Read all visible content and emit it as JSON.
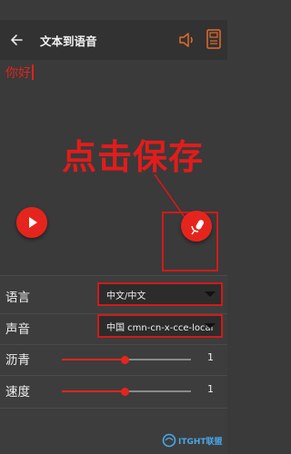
{
  "header": {
    "title": "文本到语音",
    "back_icon": "arrow-left-icon",
    "speaker_icon": "speaker-icon",
    "save_icon": "save-file-icon"
  },
  "editor": {
    "text": "你好"
  },
  "annotation": {
    "callout": "点击保存"
  },
  "actions": {
    "play_icon": "play-icon",
    "mic_icon": "microphone-icon"
  },
  "settings": {
    "language": {
      "label": "语言",
      "value": "中文/中文"
    },
    "voice": {
      "label": "声音",
      "value": "中国 cmn-cn-x-cce-local"
    },
    "pitch": {
      "label": "沥青",
      "value": "1",
      "level": 0.49
    },
    "speed": {
      "label": "速度",
      "value": "1",
      "level": 0.49
    }
  },
  "watermark": {
    "text": "ITGHT联盟"
  },
  "colors": {
    "accent": "#e5251d",
    "background": "#3a3a3a",
    "toolbar": "#323232",
    "annotation": "#d11a1a"
  }
}
